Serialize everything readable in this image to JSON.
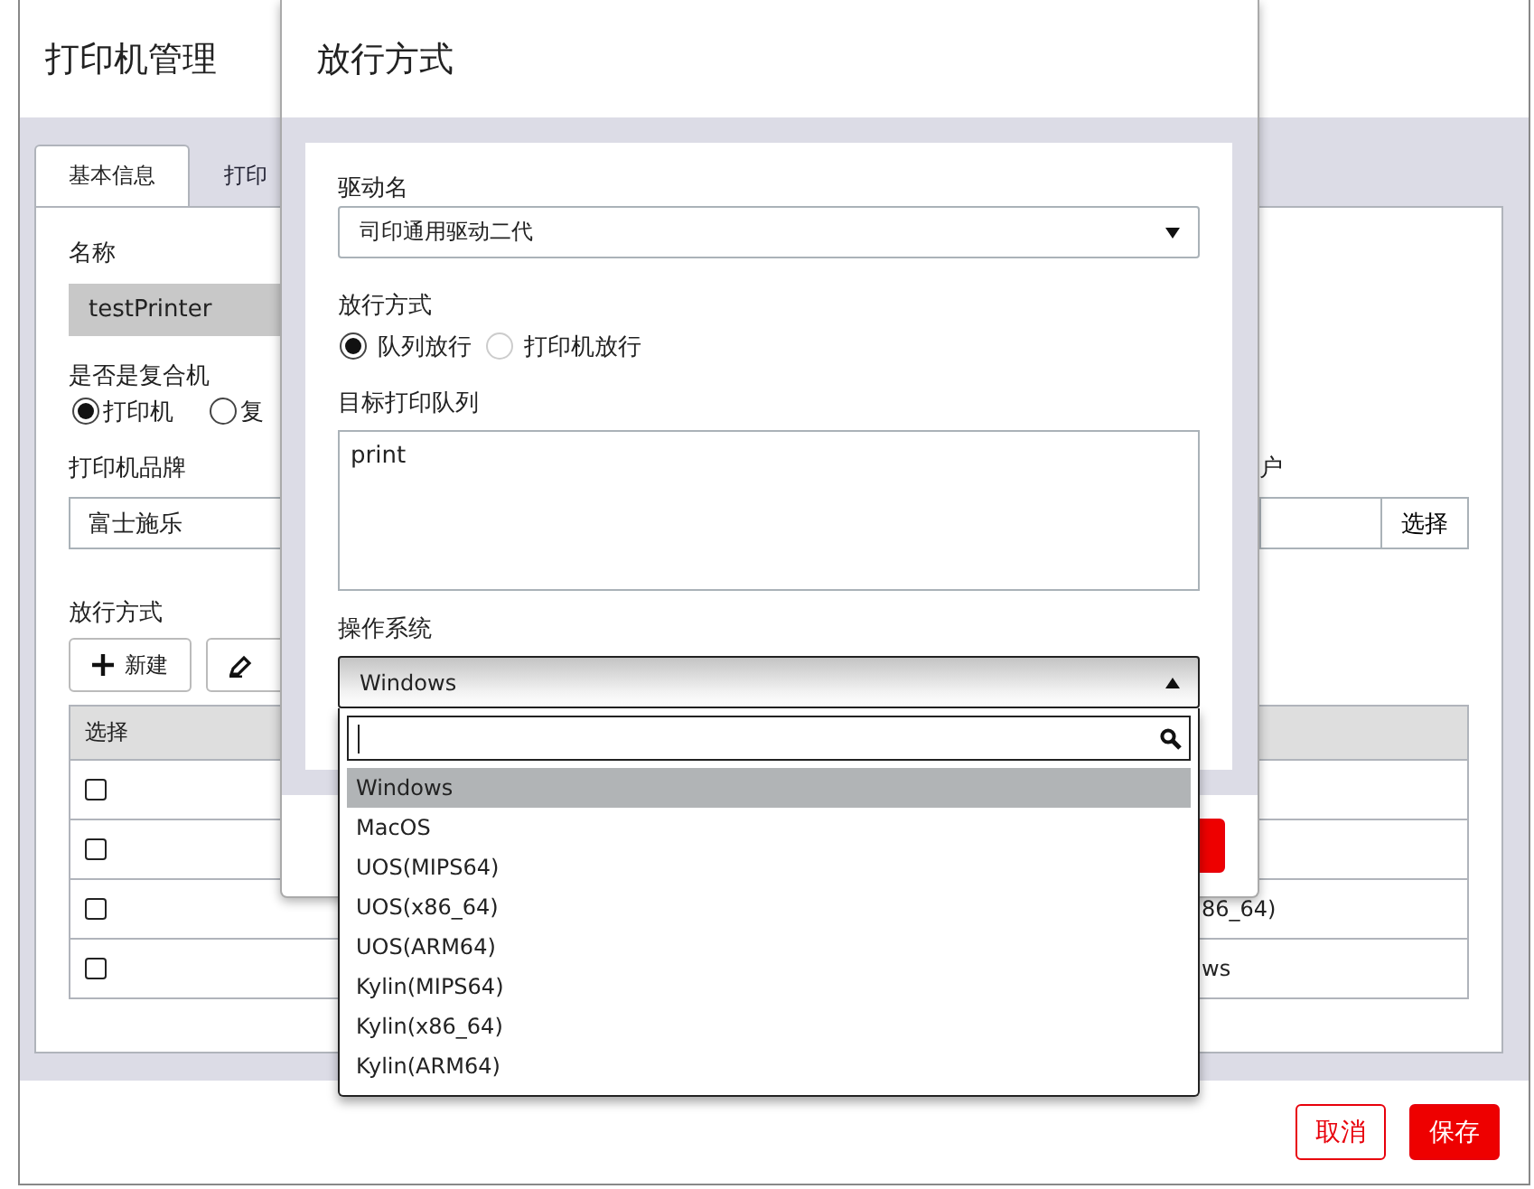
{
  "main_dialog": {
    "title": "打印机管理",
    "tabs": [
      {
        "label": "基本信息",
        "selected": true
      },
      {
        "label": "打印",
        "selected": false
      }
    ],
    "name_field": {
      "label": "名称",
      "value": "testPrinter",
      "disabled": true
    },
    "multifunction": {
      "label": "是否是复合机",
      "options": [
        {
          "label": "打印机",
          "selected": true
        },
        {
          "label": "复",
          "selected": false
        }
      ]
    },
    "brand_field": {
      "label": "打印机品牌",
      "value": "富士施乐"
    },
    "user_field": {
      "label": "户",
      "button": "选择"
    },
    "release_section": {
      "label": "放行方式",
      "buttons": [
        {
          "kind": "add",
          "label": "新建"
        },
        {
          "kind": "edit"
        }
      ]
    },
    "table": {
      "columns": [
        "选择"
      ],
      "rows": [
        {
          "checked": false
        },
        {
          "checked": false
        },
        {
          "checked": false,
          "column_2": "86_64)"
        },
        {
          "checked": false,
          "column_2": "ws"
        }
      ]
    },
    "footer_buttons": [
      {
        "kind": "secondary",
        "label": "取消"
      },
      {
        "kind": "primary",
        "label": "保存"
      }
    ]
  },
  "release_dialog": {
    "title": "放行方式",
    "driver": {
      "label": "驱动名",
      "value": "司印通用驱动二代"
    },
    "mode": {
      "label": "放行方式",
      "options": [
        {
          "label": "队列放行",
          "selected": true
        },
        {
          "label": "打印机放行",
          "selected": false
        }
      ]
    },
    "queue": {
      "label": "目标打印队列",
      "value": "print"
    },
    "os": {
      "label": "操作系统",
      "value": "Windows",
      "expanded": true,
      "options": [
        {
          "label": "Windows",
          "selected": true
        },
        {
          "label": "MacOS",
          "selected": false
        },
        {
          "label": "UOS(MIPS64)",
          "selected": false
        },
        {
          "label": "UOS(x86_64)",
          "selected": false
        },
        {
          "label": "UOS(ARM64)",
          "selected": false
        },
        {
          "label": "Kylin(MIPS64)",
          "selected": false
        },
        {
          "label": "Kylin(x86_64)",
          "selected": false
        },
        {
          "label": "Kylin(ARM64)",
          "selected": false
        }
      ]
    },
    "footer_buttons": [
      {
        "kind": "primary"
      }
    ]
  }
}
